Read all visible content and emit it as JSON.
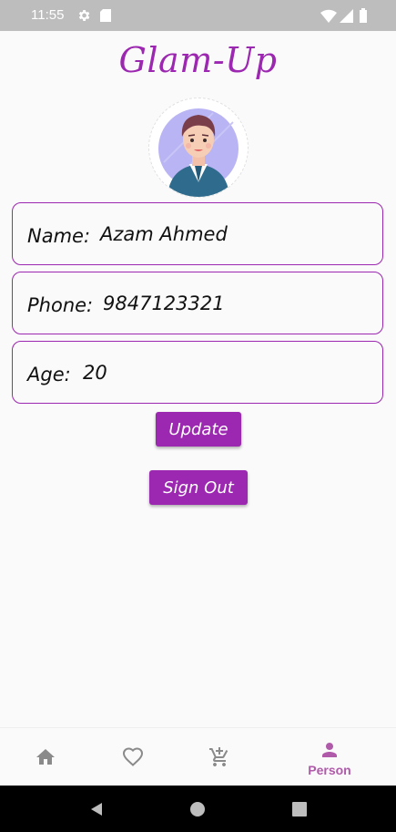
{
  "status_bar": {
    "time": "11:55"
  },
  "app": {
    "title": "Glam-Up"
  },
  "profile": {
    "name_label": "Name:",
    "name_value": "Azam Ahmed",
    "phone_label": "Phone:",
    "phone_value": "9847123321",
    "age_label": "Age:",
    "age_value": "20"
  },
  "buttons": {
    "update": "Update",
    "sign_out": "Sign Out"
  },
  "bottom_nav": {
    "items": [
      {
        "icon": "home-icon",
        "label": ""
      },
      {
        "icon": "heart-icon",
        "label": ""
      },
      {
        "icon": "cart-add-icon",
        "label": ""
      },
      {
        "icon": "person-icon",
        "label": "Person"
      }
    ],
    "active_color": "#b05aaa",
    "inactive_color": "#8a8a8a"
  },
  "colors": {
    "accent": "#9c27b0",
    "status_bar": "#bdbdbd"
  }
}
